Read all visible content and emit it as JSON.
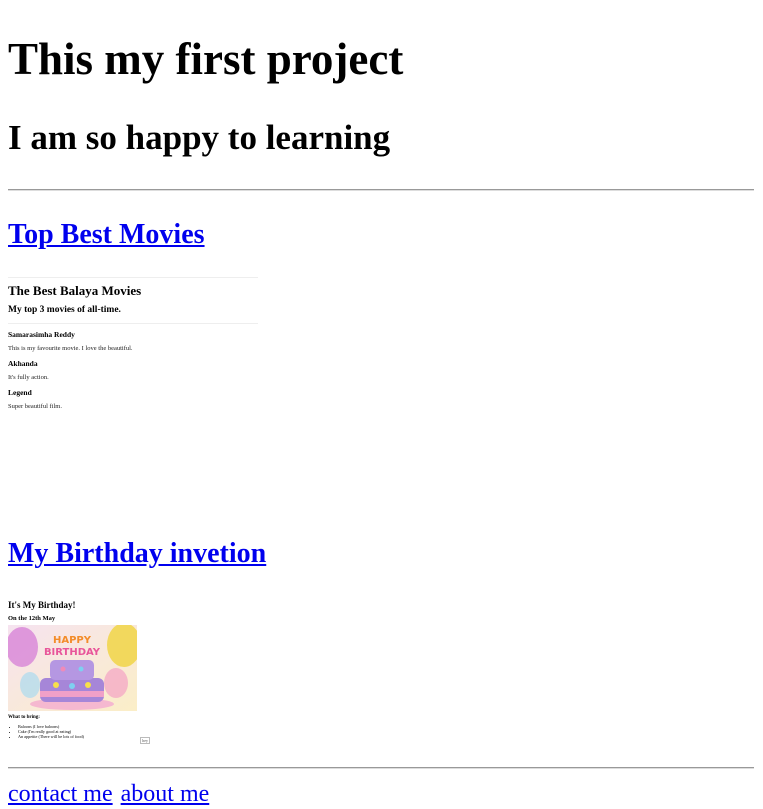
{
  "header": {
    "title": "This my first project",
    "subtitle": "I am so happy to learning"
  },
  "movies_section": {
    "link_label": "Top Best Movies",
    "embed": {
      "title": "The Best Balaya Movies",
      "subtitle": "My top 3 movies of all-time.",
      "items": [
        {
          "name": "Samarasimha Reddy",
          "text": "This is my favourite movie. I love the beautiful."
        },
        {
          "name": "Akhanda",
          "text": "It's fully action."
        },
        {
          "name": "Legend",
          "text": "Super beautiful film."
        }
      ]
    }
  },
  "birthday_section": {
    "link_label": "My Birthday invetion",
    "embed": {
      "title": "It's My Birthday!",
      "date": "On the 12th May",
      "image_caption": "HAPPY BIRTHDAY",
      "bring_heading": "What to bring:",
      "bring_items": [
        "Baloons (I love baloons)",
        "Cake (I'm really good at eating)",
        "An appetite (There will be lots of food)"
      ],
      "scroll_label": "hey"
    }
  },
  "footer": {
    "links": [
      "contact me",
      "about me"
    ]
  },
  "colors": {
    "link": "#0000ee",
    "text": "#000000",
    "rule": "#999999"
  }
}
